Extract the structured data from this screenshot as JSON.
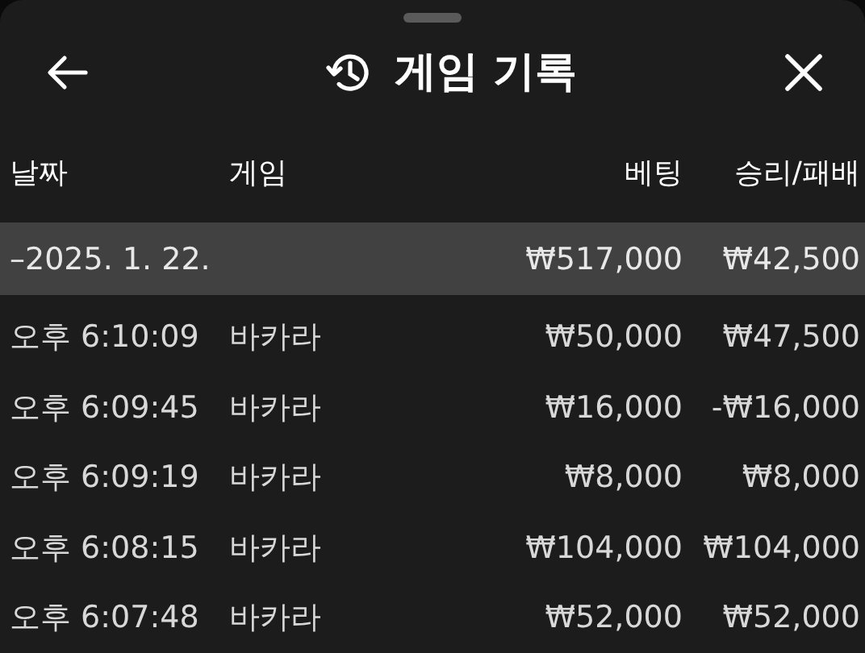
{
  "header": {
    "title": "게임 기록"
  },
  "table": {
    "columns": [
      "날짜",
      "게임",
      "베팅",
      "승리/패배"
    ],
    "group": {
      "date": "–2025. 1. 22.",
      "bet": "₩517,000",
      "result": "₩42,500",
      "selected": true
    },
    "rows": [
      {
        "time": "오후 6:10:09",
        "game": "바카라",
        "bet": "₩50,000",
        "result": "₩47,500"
      },
      {
        "time": "오후 6:09:45",
        "game": "바카라",
        "bet": "₩16,000",
        "result": "-₩16,000"
      },
      {
        "time": "오후 6:09:19",
        "game": "바카라",
        "bet": "₩8,000",
        "result": "₩8,000"
      },
      {
        "time": "오후 6:08:15",
        "game": "바카라",
        "bet": "₩104,000",
        "result": "₩104,000"
      },
      {
        "time": "오후 6:07:48",
        "game": "바카라",
        "bet": "₩52,000",
        "result": "₩52,000"
      }
    ]
  }
}
